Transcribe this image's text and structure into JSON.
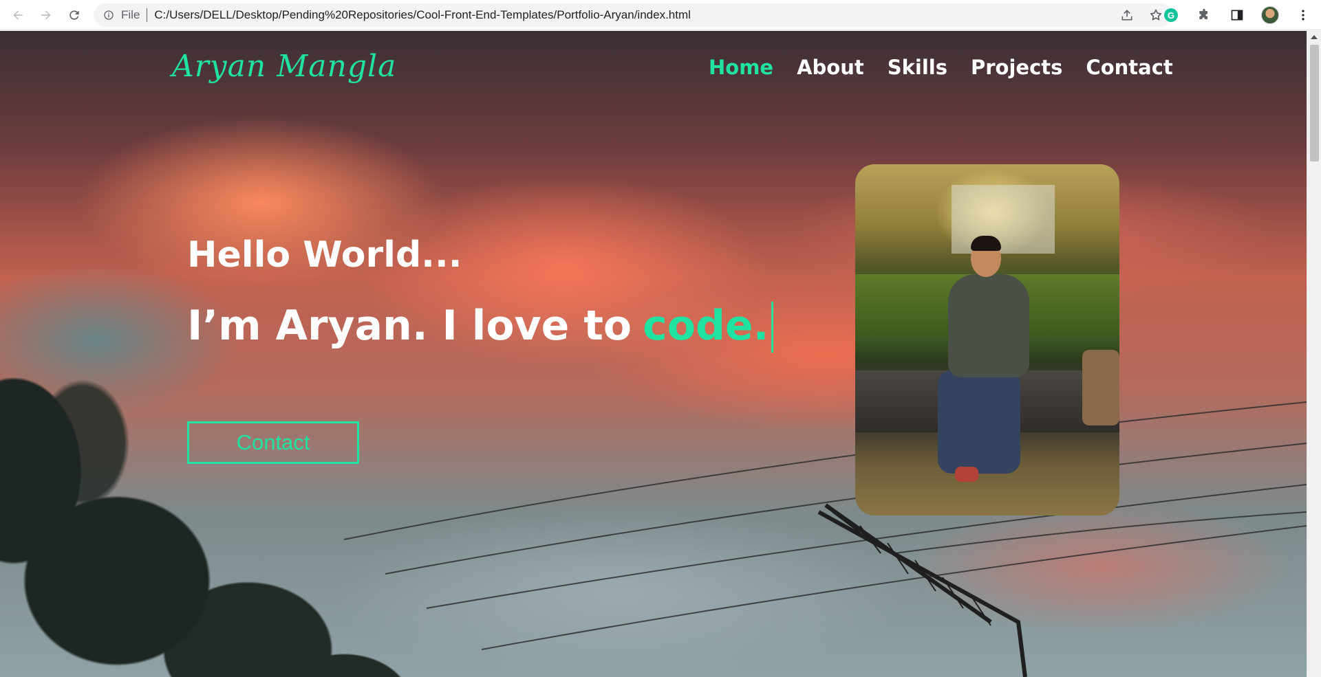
{
  "browser": {
    "back_icon": "arrow-left-icon",
    "forward_icon": "arrow-right-icon",
    "reload_icon": "reload-icon",
    "site_info_icon": "info-icon",
    "scheme_label": "File",
    "url": "C:/Users/DELL/Desktop/Pending%20Repositories/Cool-Front-End-Templates/Portfolio-Aryan/index.html",
    "share_icon": "share-icon",
    "bookmark_icon": "star-icon",
    "extensions": [
      {
        "icon": "grammarly-icon",
        "glyph": "G"
      },
      {
        "icon": "puzzle-icon"
      },
      {
        "icon": "side-panel-icon"
      },
      {
        "icon": "profile-avatar"
      },
      {
        "icon": "more-vert-icon"
      }
    ]
  },
  "site": {
    "logo": "Aryan Mangla",
    "nav": [
      {
        "label": "Home",
        "active": true
      },
      {
        "label": "About",
        "active": false
      },
      {
        "label": "Skills",
        "active": false
      },
      {
        "label": "Projects",
        "active": false
      },
      {
        "label": "Contact",
        "active": false
      }
    ],
    "hero": {
      "greeting": "Hello World...",
      "intro": "I’m Aryan. I love to",
      "typed_word": "code.",
      "cta_label": "Contact"
    }
  },
  "colors": {
    "accent": "#20e3a2",
    "text": "#ffffff"
  }
}
